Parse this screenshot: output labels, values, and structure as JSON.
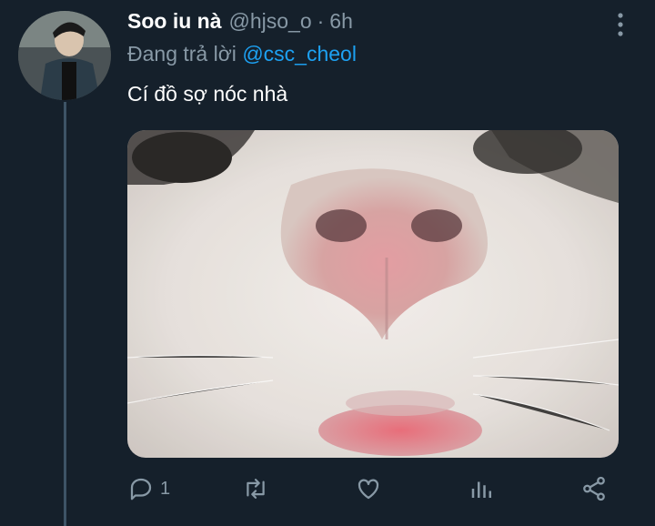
{
  "tweet": {
    "author_name": "Soo iu nà",
    "handle": "@hjso_o",
    "separator": "·",
    "time": "6h",
    "reply_prefix": "Đang trả lời",
    "reply_mention": "@csc_cheol",
    "text": "Cí đồ sợ nóc nhà",
    "media_icon": "photo-cat-nose-closeup"
  },
  "actions": {
    "reply_count": "1",
    "icons": [
      "reply-icon",
      "retweet-icon",
      "like-icon",
      "analytics-icon",
      "share-icon"
    ]
  },
  "colors": {
    "background": "#15202b",
    "secondary_text": "#8899a6",
    "link": "#1da1f2",
    "thread_line": "#3d5466"
  }
}
